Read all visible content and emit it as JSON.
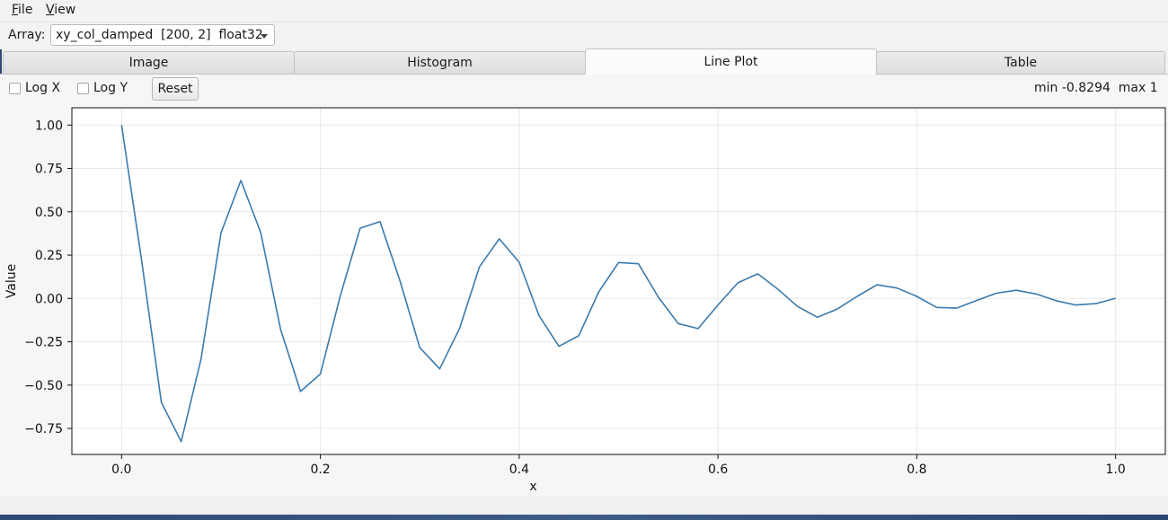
{
  "menu": {
    "file_label": "File",
    "view_label": "View"
  },
  "array_selector": {
    "label": "Array:",
    "selected": "xy_col_damped  [200, 2]  float32"
  },
  "tabs": [
    {
      "label": "Image",
      "active": false
    },
    {
      "label": "Histogram",
      "active": false
    },
    {
      "label": "Line Plot",
      "active": true
    },
    {
      "label": "Table",
      "active": false
    }
  ],
  "plot_controls": {
    "log_x_label": "Log X",
    "log_x_checked": false,
    "log_y_label": "Log Y",
    "log_y_checked": false,
    "reset_label": "Reset"
  },
  "stats": {
    "text": "min -0.8294  max 1"
  },
  "colors": {
    "line": "#3a7aad",
    "grid": "#e8e8e8",
    "plot_bg": "#ffffff"
  },
  "chart_data": {
    "type": "line",
    "xlabel": "x",
    "ylabel": "Value",
    "xlim": [
      -0.05,
      1.05
    ],
    "ylim": [
      -0.9,
      1.1
    ],
    "xticks": [
      0.0,
      0.2,
      0.4,
      0.6,
      0.8,
      1.0
    ],
    "xtick_labels": [
      "0.0",
      "0.2",
      "0.4",
      "0.6",
      "0.8",
      "1.0"
    ],
    "yticks": [
      1.0,
      0.75,
      0.5,
      0.25,
      0.0,
      -0.25,
      -0.5,
      -0.75
    ],
    "ytick_labels": [
      "1.00",
      "0.75",
      "0.50",
      "0.25",
      "0.00",
      "−0.25",
      "−0.50",
      "−0.75"
    ],
    "grid": true,
    "series": [
      {
        "x": [
          0.0,
          0.02,
          0.04,
          0.06,
          0.08,
          0.1,
          0.12,
          0.14,
          0.16,
          0.18,
          0.2,
          0.22,
          0.24,
          0.26,
          0.28,
          0.3,
          0.32,
          0.34,
          0.36,
          0.38,
          0.4,
          0.42,
          0.44,
          0.46,
          0.48,
          0.5,
          0.52,
          0.54,
          0.56,
          0.58,
          0.6,
          0.62,
          0.64,
          0.66,
          0.68,
          0.7,
          0.72,
          0.74,
          0.76,
          0.78,
          0.8,
          0.82,
          0.84,
          0.86,
          0.88,
          0.9,
          0.92,
          0.94,
          0.96,
          0.98,
          1.0
        ],
        "y": [
          1.0,
          0.227,
          -0.6,
          -0.826,
          -0.348,
          0.378,
          0.681,
          0.38,
          -0.178,
          -0.537,
          -0.436,
          0.014,
          0.405,
          0.443,
          0.103,
          -0.284,
          -0.406,
          -0.173,
          0.182,
          0.344,
          0.209,
          -0.1,
          -0.276,
          -0.215,
          0.038,
          0.207,
          0.2,
          0.007,
          -0.145,
          -0.174,
          -0.038,
          0.09,
          0.142,
          0.055,
          -0.046,
          -0.109,
          -0.061,
          0.012,
          0.079,
          0.06,
          0.012,
          -0.052,
          -0.056,
          -0.012,
          0.03,
          0.047,
          0.026,
          -0.013,
          -0.038,
          -0.03,
          0.001
        ]
      }
    ]
  }
}
